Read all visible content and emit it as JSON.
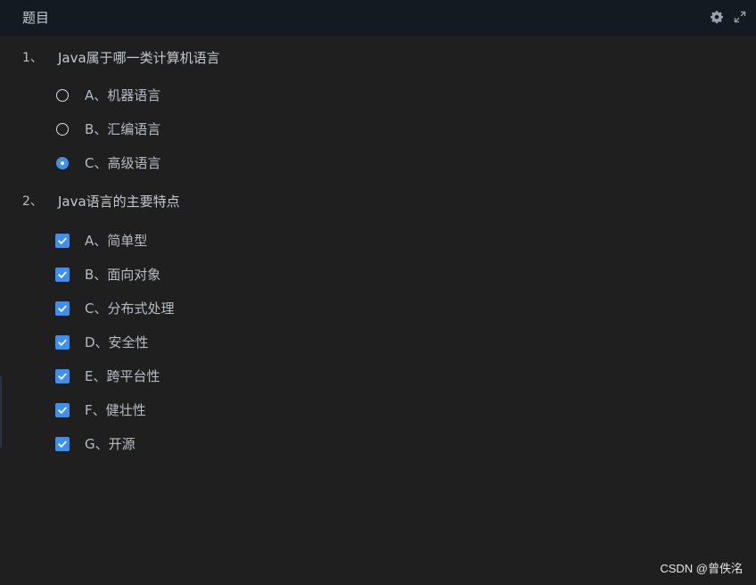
{
  "header": {
    "title": "题目",
    "icons": [
      "gear-icon",
      "expand-icon"
    ]
  },
  "questions": [
    {
      "number": "1、",
      "text": "Java属于哪一类计算机语言",
      "type": "single",
      "options": [
        {
          "label": "A、机器语言",
          "checked": false
        },
        {
          "label": "B、汇编语言",
          "checked": false
        },
        {
          "label": "C、高级语言",
          "checked": true
        }
      ]
    },
    {
      "number": "2、",
      "text": "Java语言的主要特点",
      "type": "multiple",
      "options": [
        {
          "label": "A、简单型",
          "checked": true
        },
        {
          "label": "B、面向对象",
          "checked": true
        },
        {
          "label": "C、分布式处理",
          "checked": true
        },
        {
          "label": "D、安全性",
          "checked": true
        },
        {
          "label": "E、跨平台性",
          "checked": true
        },
        {
          "label": "F、健壮性",
          "checked": true
        },
        {
          "label": "G、开源",
          "checked": true
        }
      ]
    }
  ],
  "watermark": "CSDN @曾佚洺",
  "colors": {
    "accent": "#3d8ff0",
    "background": "#1f1f1f",
    "header": "#131a22"
  }
}
